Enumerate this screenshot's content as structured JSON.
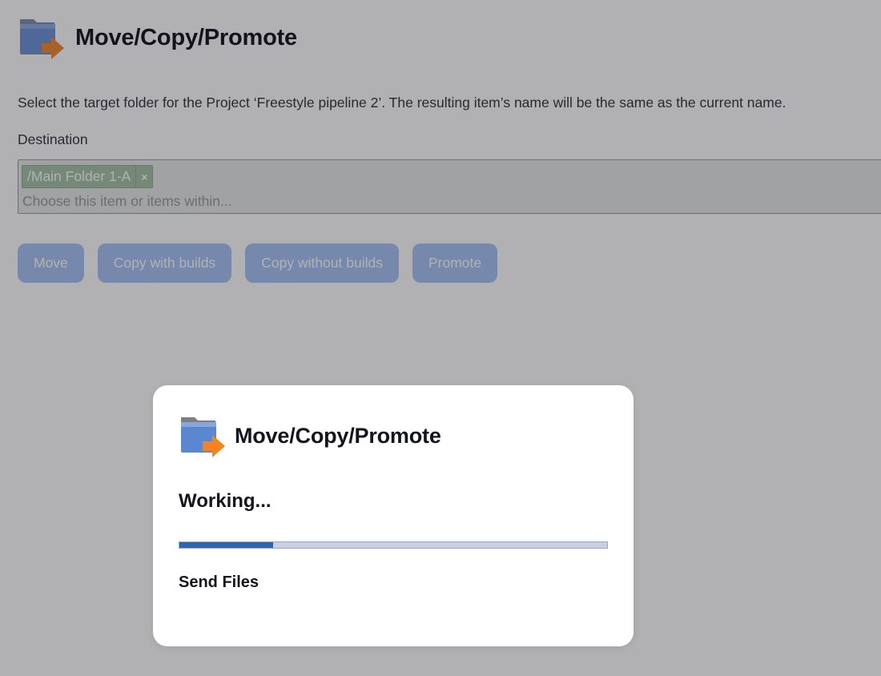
{
  "page": {
    "title": "Move/Copy/Promote",
    "description": "Select the target folder for the Project ‘Freestyle pipeline 2’. The resulting item’s name will be the same as the current name.",
    "destination_label": "Destination",
    "destination": {
      "selected_tag": "/Main Folder 1-A",
      "remove_glyph": "×",
      "placeholder": "Choose this item or items within..."
    },
    "buttons": {
      "move": "Move",
      "copy_with_builds": "Copy with builds",
      "copy_without_builds": "Copy without builds",
      "promote": "Promote"
    }
  },
  "dialog": {
    "title": "Move/Copy/Promote",
    "status": "Working...",
    "progress": 0.22,
    "step": "Send Files"
  },
  "icons": {
    "header": "folder-move-icon",
    "dialog": "folder-move-icon"
  },
  "colors": {
    "button": "#a8c4f5",
    "progress_fill": "#2d64b3",
    "progress_track": "#c9d1de",
    "tag_background": "#a8c4a8"
  }
}
